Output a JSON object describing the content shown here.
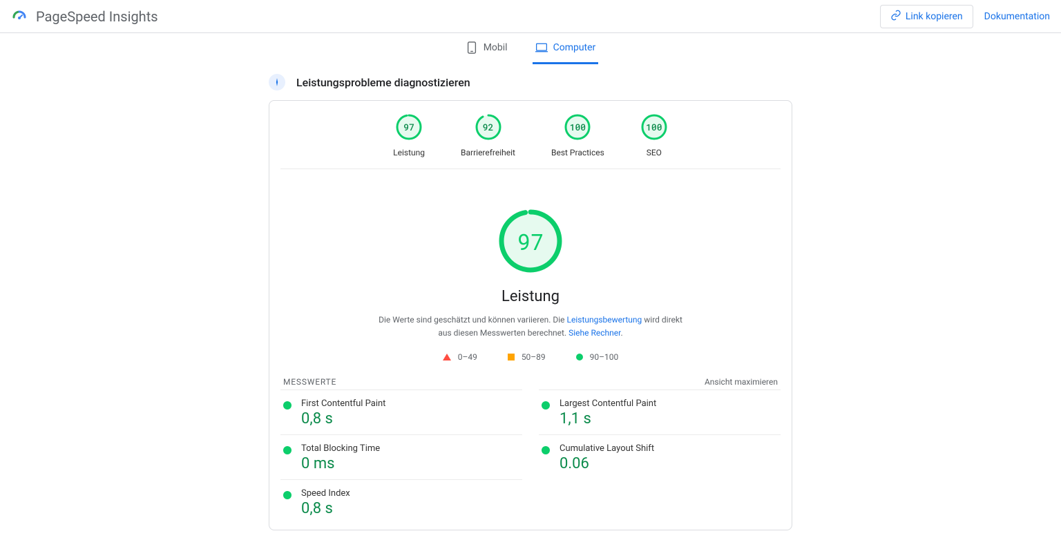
{
  "header": {
    "title": "PageSpeed Insights",
    "copy_link": "Link kopieren",
    "documentation": "Dokumentation"
  },
  "tabs": {
    "mobile": "Mobil",
    "desktop": "Computer"
  },
  "section": {
    "title": "Leistungsprobleme diagnostizieren"
  },
  "gauges": [
    {
      "score": "97",
      "label": "Leistung",
      "pct": 97
    },
    {
      "score": "92",
      "label": "Barrierefreiheit",
      "pct": 92
    },
    {
      "score": "100",
      "label": "Best Practices",
      "pct": 100
    },
    {
      "score": "100",
      "label": "SEO",
      "pct": 100
    }
  ],
  "main_gauge": {
    "score": "97",
    "pct": 97,
    "title": "Leistung",
    "desc_1": "Die Werte sind geschätzt und können variieren. Die ",
    "link_1": "Leistungsbewertung",
    "desc_2": " wird direkt aus diesen Messwerten berechnet. ",
    "link_2": "Siehe Rechner"
  },
  "legend": {
    "r0": "0–49",
    "r1": "50–89",
    "r2": "90–100"
  },
  "metrics_header": {
    "left": "MESSWERTE",
    "right": "Ansicht maximieren"
  },
  "metrics": [
    {
      "name": "First Contentful Paint",
      "value": "0,8 s"
    },
    {
      "name": "Largest Contentful Paint",
      "value": "1,1 s"
    },
    {
      "name": "Total Blocking Time",
      "value": "0 ms"
    },
    {
      "name": "Cumulative Layout Shift",
      "value": "0.06"
    },
    {
      "name": "Speed Index",
      "value": "0,8 s"
    }
  ]
}
